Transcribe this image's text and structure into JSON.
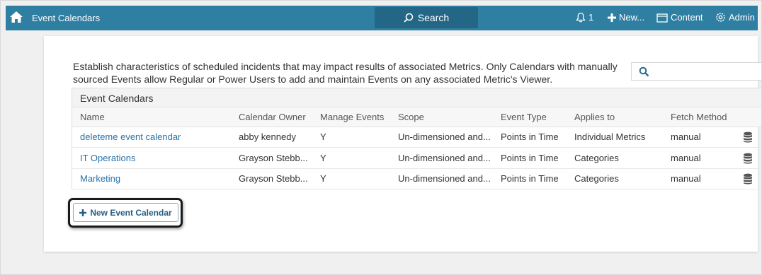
{
  "topbar": {
    "title": "Event Calendars",
    "search_label": "Search",
    "notifications_count": "1",
    "new_label": "New...",
    "content_label": "Content",
    "admin_label": "Admin"
  },
  "main": {
    "description": "Establish characteristics of scheduled incidents that may impact results of associated Metrics. Only Calendars with manually sourced Events allow Regular or Power Users to add and maintain Events on any associated Metric's Viewer.",
    "filter_placeholder": "",
    "panel_title": "Event Calendars",
    "columns": [
      "Name",
      "Calendar Owner",
      "Manage Events",
      "Scope",
      "Event Type",
      "Applies to",
      "Fetch Method"
    ],
    "rows": [
      {
        "name": "deleteme event calendar",
        "owner": "abby kennedy",
        "manage": "Y",
        "scope": "Un-dimensioned and...",
        "event_type": "Points in Time",
        "applies_to": "Individual Metrics",
        "fetch": "manual"
      },
      {
        "name": "IT Operations",
        "owner": "Grayson Stebb...",
        "manage": "Y",
        "scope": "Un-dimensioned and...",
        "event_type": "Points in Time",
        "applies_to": "Categories",
        "fetch": "manual"
      },
      {
        "name": "Marketing",
        "owner": "Grayson Stebb...",
        "manage": "Y",
        "scope": "Un-dimensioned and...",
        "event_type": "Points in Time",
        "applies_to": "Categories",
        "fetch": "manual"
      }
    ],
    "new_button_label": "New Event Calendar"
  },
  "colors": {
    "topbar": "#2f7fa3",
    "search_button": "#236685",
    "link": "#2a73a8",
    "button_text": "#235d85"
  },
  "icons": [
    "home-icon",
    "search-icon",
    "bell-icon",
    "plus-icon",
    "content-icon",
    "gear-icon",
    "database-icon"
  ]
}
